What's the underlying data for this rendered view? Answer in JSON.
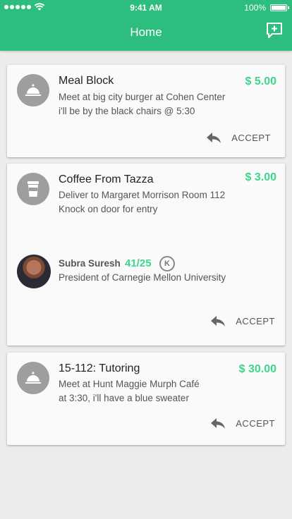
{
  "status_bar": {
    "time": "9:41 AM",
    "battery": "100%"
  },
  "header": {
    "title": "Home"
  },
  "colors": {
    "primary": "#2dbd7e",
    "price": "#3dd68c",
    "icon_bg": "#9e9e9e"
  },
  "cards": [
    {
      "icon": "cloche-icon",
      "title": "Meal Block",
      "price": "$ 5.00",
      "line1": "Meet at big city burger at Cohen Center",
      "line2": "i'll be by the black chairs @ 5:30",
      "action": "ACCEPT"
    },
    {
      "icon": "coffee-cup-icon",
      "title": "Coffee From Tazza",
      "price": "$ 3.00",
      "line1": "Deliver to Margaret Morrison Room 112",
      "line2": "Knock on door for entry",
      "person": {
        "name": "Subra Suresh",
        "score": "41/25",
        "badge": "K",
        "role": "President of Carnegie Mellon University"
      },
      "action": "ACCEPT"
    },
    {
      "icon": "cloche-icon",
      "title": "15-112: Tutoring",
      "price": "$ 30.00",
      "line1": "Meet at Hunt Maggie Murph Café",
      "line2": "at 3:30, i'll have a blue sweater",
      "action": "ACCEPT"
    }
  ]
}
